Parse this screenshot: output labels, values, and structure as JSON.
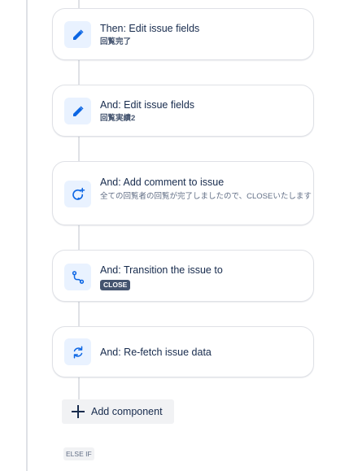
{
  "colors": {
    "accent": "#0c66e4",
    "icon_bg": "#e9f2ff",
    "border": "#dfe1e6",
    "lozenge_bg": "#44546f"
  },
  "steps": [
    {
      "icon": "pencil-icon",
      "title": "Then: Edit issue fields",
      "subtitle": "回覧完了"
    },
    {
      "icon": "pencil-icon",
      "title": "And: Edit issue fields",
      "subtitle": "回覧実績2"
    },
    {
      "icon": "comment-add-icon",
      "title": "And: Add comment to issue",
      "description": "全ての回覧者の回覧が完了しましたので、CLOSEいたします"
    },
    {
      "icon": "transition-icon",
      "title": "And: Transition the issue to",
      "status": "CLOSE"
    },
    {
      "icon": "refresh-icon",
      "title": "And: Re-fetch issue data"
    }
  ],
  "add_component": {
    "label": "Add component"
  },
  "else_if": {
    "label": "ELSE IF"
  }
}
